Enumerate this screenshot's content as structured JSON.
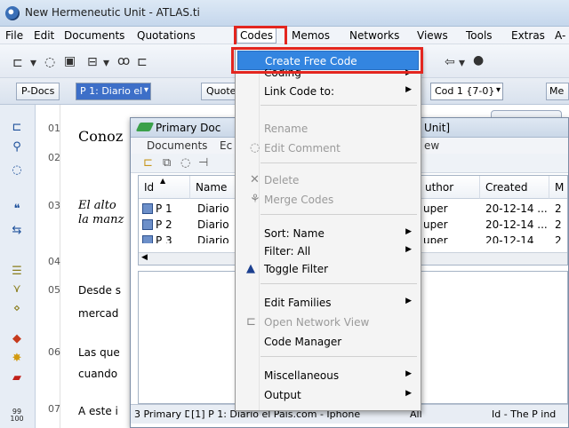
{
  "window": {
    "title": "New Hermeneutic Unit - ATLAS.ti"
  },
  "menubar": [
    "File",
    "Edit",
    "Documents",
    "Quotations",
    "Codes",
    "Memos",
    "Networks",
    "Views",
    "Tools",
    "Extras",
    "A-"
  ],
  "toolbar": {
    "pdocs_label": "P-Docs",
    "pdoc_selected": "P 1: Diario el",
    "quotes_label": "Quote",
    "code_combo": "Cod 1 {7-0}",
    "memos_label": "Me"
  },
  "document": {
    "line_numbers": [
      "01",
      "02",
      "03",
      "04",
      "05",
      "06",
      "07"
    ],
    "lines": [
      {
        "text": "Conoz"
      },
      {
        "text": "El alto"
      },
      {
        "text": "la manz"
      },
      {
        "text": "Desde s"
      },
      {
        "text": "mercad"
      },
      {
        "text": "Las que"
      },
      {
        "text": "cuando"
      },
      {
        "text": "A este i"
      }
    ],
    "bottom_number": "99\n100"
  },
  "primary_doc_window": {
    "title_left": "Primary Doc",
    "title_right": "Unit]",
    "menu": [
      "Documents",
      "Ec",
      "ew"
    ],
    "columns": [
      "Id",
      "Name",
      "uthor",
      "Created",
      "M"
    ],
    "rows": [
      {
        "id": "P 1",
        "name": "Diario",
        "author": "uper",
        "created": "20-12-14 ...",
        "m": "2"
      },
      {
        "id": "P 2",
        "name": "Diario",
        "author": "uper",
        "created": "20-12-14 ...",
        "m": "2"
      },
      {
        "id": "P 3",
        "name": "Diario",
        "author": "uper",
        "created": "20-12-14",
        "m": "2"
      }
    ],
    "status": {
      "left": "3 Primary Doc",
      "middle": "[1] P 1: Diario el Pais.com - Iphone",
      "filter": "All",
      "right": "Id - The P ind"
    }
  },
  "codes_menu": {
    "items": [
      {
        "label": "Create Free Code",
        "selected": true
      },
      {
        "label": "Coding",
        "submenu": true
      },
      {
        "label": "Link Code to:",
        "submenu": true
      },
      {
        "label": "Rename",
        "disabled": true
      },
      {
        "label": "Edit Comment",
        "disabled": true,
        "icon": "edit-comment-icon"
      },
      {
        "label": "Delete",
        "disabled": true,
        "icon": "delete-icon"
      },
      {
        "label": "Merge Codes",
        "disabled": true,
        "icon": "merge-icon"
      },
      {
        "label": "Sort: Name",
        "submenu": true
      },
      {
        "label": "Filter: All",
        "submenu": true
      },
      {
        "label": "Toggle Filter",
        "icon": "filter-icon"
      },
      {
        "label": "Edit Families",
        "submenu": true
      },
      {
        "label": "Open Network View",
        "disabled": true,
        "icon": "network-icon"
      },
      {
        "label": "Code Manager"
      },
      {
        "label": "Miscellaneous",
        "submenu": true
      },
      {
        "label": "Output",
        "submenu": true
      }
    ]
  },
  "colors": {
    "highlight_red": "#e3261f",
    "menu_selected": "#3385e0"
  }
}
